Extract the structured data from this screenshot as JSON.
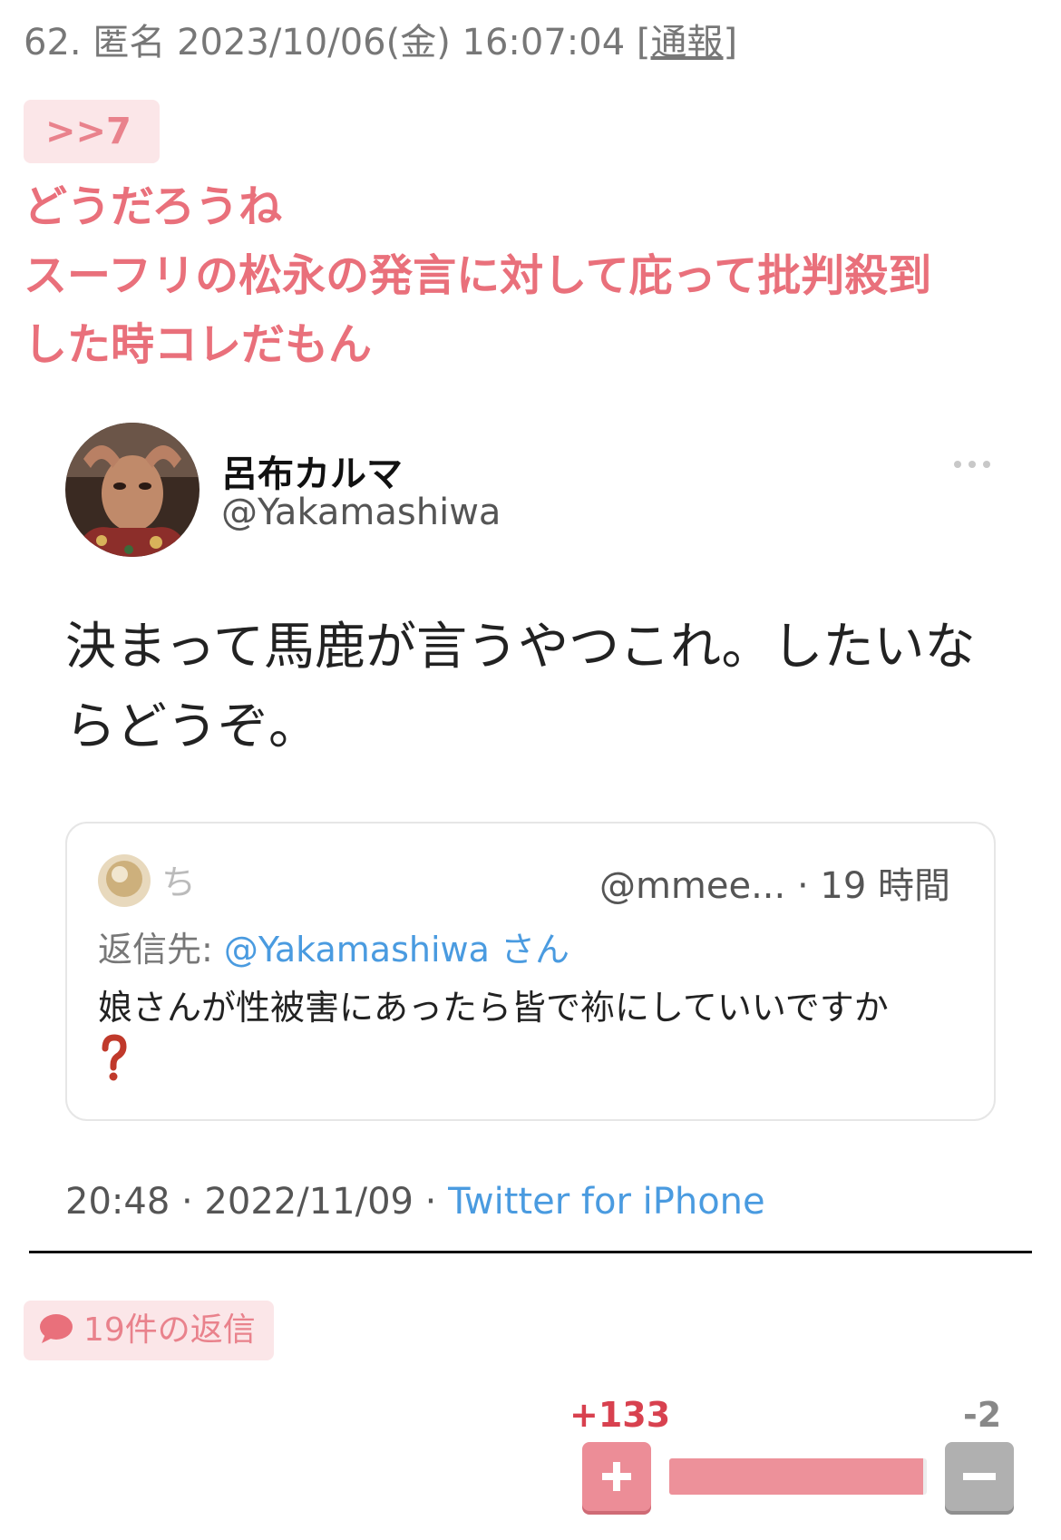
{
  "post": {
    "number": "62.",
    "author": "匿名",
    "datetime": "2023/10/06(金) 16:07:04",
    "report_open": "[",
    "report_label": "通報",
    "report_close": "]",
    "anchor": ">>7",
    "body_lines": [
      "どうだろうね",
      "スーフリの松永の発言に対して庇って批判殺到",
      "した時コレだもん"
    ]
  },
  "tweet": {
    "display_name": "呂布カルマ",
    "handle": "@Yakamashiwa",
    "text": "決まって馬鹿が言うやつこれ。したいならどうぞ。",
    "quote": {
      "name": "ち",
      "handle_time": "@mmee... · 19 時間",
      "reply_prefix": "返信先: ",
      "reply_mention": "@Yakamashiwa さん",
      "text": "娘さんが性被害にあったら皆で袮にしていいですか"
    },
    "time": "20:48 · 2022/11/09 · ",
    "source": "Twitter for iPhone"
  },
  "replies": {
    "label": "19件の返信"
  },
  "votes": {
    "plus": "+133",
    "minus": "-2",
    "plus_ratio": 0.985
  },
  "colors": {
    "accent_pink": "#e9707b",
    "badge_bg": "#fbe6e8",
    "link_blue": "#4a9be0",
    "plus_button": "#ec8d97",
    "minus_button": "#b0b0b0"
  },
  "icons": [
    "avatar",
    "more-icon",
    "question-icon",
    "speech-bubble-icon",
    "plus-icon",
    "minus-icon"
  ]
}
